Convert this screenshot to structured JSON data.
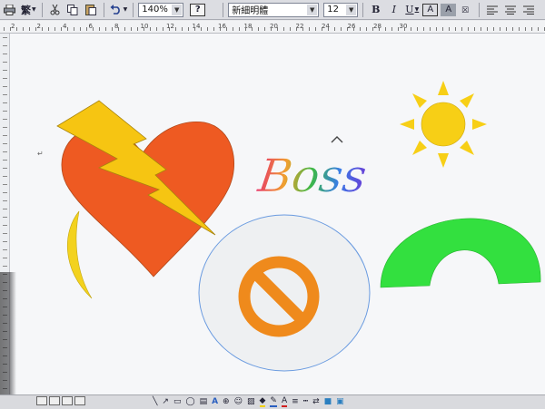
{
  "toolbar": {
    "print_icon": "printer-icon",
    "script_label": "繁",
    "cut_icon": "scissors-icon",
    "copy_icon": "copy-icon",
    "paste_icon": "paste-icon",
    "undo_icon": "undo-icon",
    "zoom_value": "140%",
    "help_label": "?",
    "font_name": "新細明體",
    "font_size": "12",
    "bold_label": "B",
    "italic_label": "I",
    "underline_label": "U",
    "char_border_label": "A",
    "char_shade_label": "A"
  },
  "ruler": {
    "labels": [
      "2",
      "2",
      "4",
      "6",
      "8",
      "10",
      "12",
      "14",
      "16",
      "18",
      "20",
      "22",
      "24",
      "26",
      "28",
      "30"
    ]
  },
  "document": {
    "wordart_text": "Boss",
    "colors": {
      "heart": "#ee5a22",
      "lightning": "#f6c512",
      "moon": "#f3d21e",
      "sun": "#f7cf16",
      "no_symbol": "#ef8a1c",
      "arch": "#33e03f",
      "circle_outline": "#6a9be0"
    }
  },
  "drawing_toolbar": {
    "text_label": "A"
  }
}
